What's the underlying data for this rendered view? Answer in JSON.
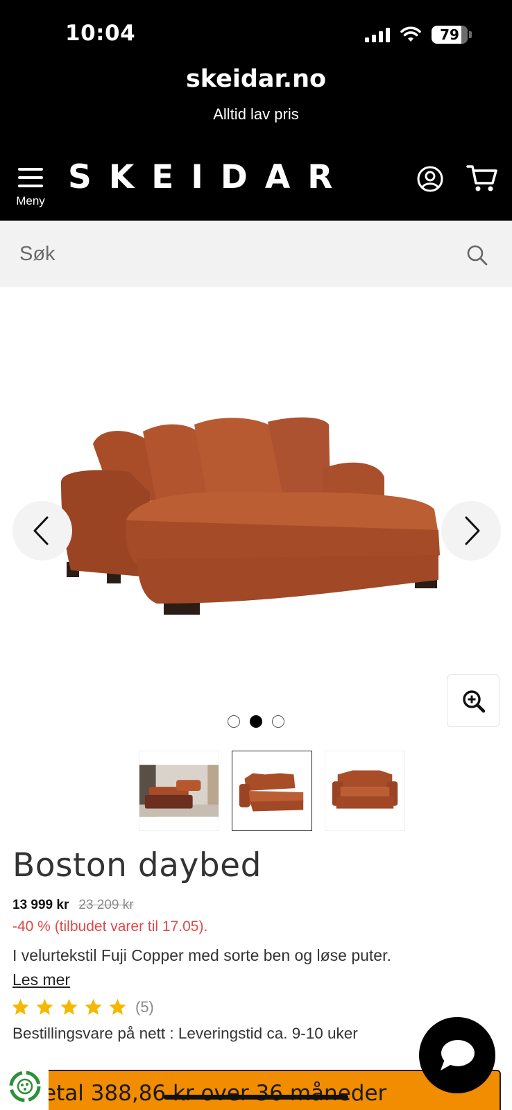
{
  "status_bar": {
    "time": "10:04",
    "battery": "79"
  },
  "browser": {
    "url": "skeidar.no",
    "subtitle": "Alltid lav pris"
  },
  "header": {
    "menu_label": "Meny",
    "logo": "SKEIDAR"
  },
  "search": {
    "placeholder": "Søk"
  },
  "gallery": {
    "slide_count": 3,
    "active_slide": 2,
    "thumbnail_count": 3,
    "active_thumbnail": 2
  },
  "product": {
    "title": "Boston daybed",
    "price": "13 999 kr",
    "old_price": "23 209 kr",
    "discount": "-40 % (tilbudet varer til 17.05).",
    "description": "I velurtekstil Fuji Copper med sorte ben og løse puter.",
    "read_more": "Les mer",
    "rating_stars": 5,
    "rating_count": "(5)",
    "delivery": "Bestillingsvare på nett : Leveringstid ca. 9-10 uker"
  },
  "finance": {
    "text": "etal 388,86 kr over 36 måneder"
  },
  "colors": {
    "accent": "#f28c00",
    "sale": "#e04848",
    "star": "#f5b800",
    "product": "#b65a30"
  }
}
